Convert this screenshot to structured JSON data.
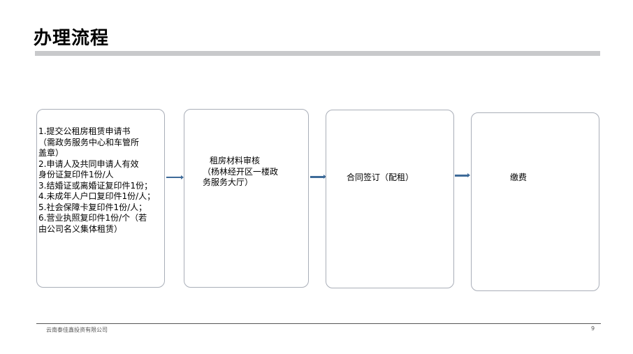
{
  "slide": {
    "title": "办理流程",
    "steps": [
      {
        "lines": [
          "1.提交公租房租赁申请书",
          "（需政务服务中心和车管所",
          "盖章）",
          "2.申请人及共同申请人有效",
          "身份证复印件1份/人",
          "3.结婚证或离婚证复印件1份；",
          "4.未成年人户口复印件1份/人；",
          "5.社会保障卡复印件1份/人；",
          "6.营业执照复印件1份/个（若",
          "由公司名义集体租赁）"
        ]
      },
      {
        "lines": [
          "租房材料审核",
          "（杨林经开区一楼政",
          "务服务大厅）"
        ]
      },
      {
        "label": "合同签订（配租）"
      },
      {
        "label": "缴费"
      }
    ],
    "colors": {
      "arrow": "#3e6b99",
      "title_bar": "#c8c9cb",
      "box_border": "#a9aeb8"
    }
  },
  "footer": {
    "company": "云南泰佳鑫投资有限公司",
    "page_number": "9"
  }
}
